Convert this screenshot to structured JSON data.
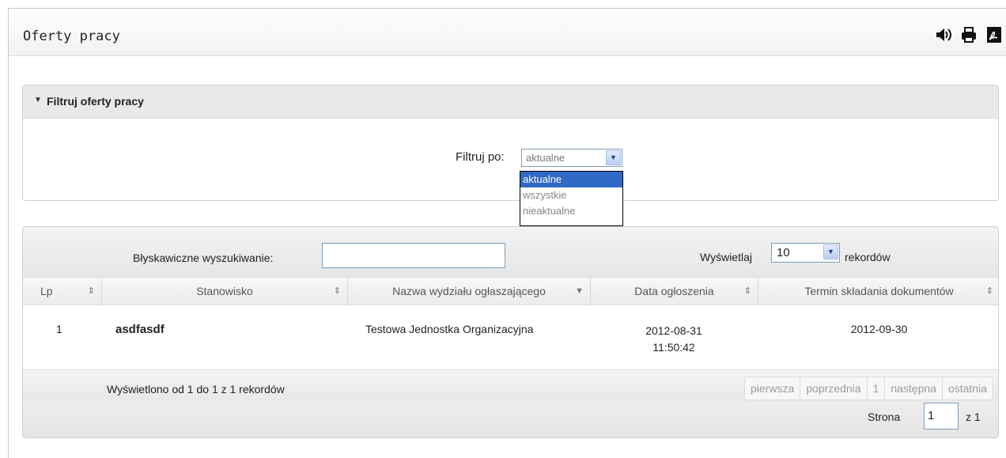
{
  "panel": {
    "title": "Oferty pracy"
  },
  "header_icons": [
    "speaker-icon",
    "printer-icon",
    "pdf-icon"
  ],
  "filter": {
    "heading": "Filtruj oferty pracy",
    "label": "Filtruj po:",
    "selected": "aktualne",
    "options": [
      "aktualne",
      "wszystkie",
      "nieaktualne"
    ]
  },
  "table_controls": {
    "search_label": "Błyskawiczne wyszukiwanie:",
    "search_value": "",
    "show_label": "Wyświetlaj",
    "page_length": "10",
    "records_label": "rekordów"
  },
  "table": {
    "columns": [
      "Lp",
      "Stanowisko",
      "Nazwa wydziału ogłaszającego",
      "Data ogłoszenia",
      "Termin składania dokumentów"
    ],
    "rows": [
      {
        "lp": "1",
        "stanowisko": "asdfasdf",
        "nazwa": "Testowa Jednostka Organizacyjna",
        "data_date": "2012-08-31",
        "data_time": "11:50:42",
        "termin": "2012-09-30"
      }
    ]
  },
  "footer": {
    "info": "Wyświetlono od 1 do 1 z 1 rekordów",
    "pager": [
      "pierwsza",
      "poprzednia",
      "1",
      "następna",
      "ostatnia"
    ],
    "page_label": "Strona",
    "page_value": "1",
    "page_of": "z 1"
  },
  "colors": {
    "selected_option": "#3169c6",
    "select_border": "#7f9db9"
  }
}
